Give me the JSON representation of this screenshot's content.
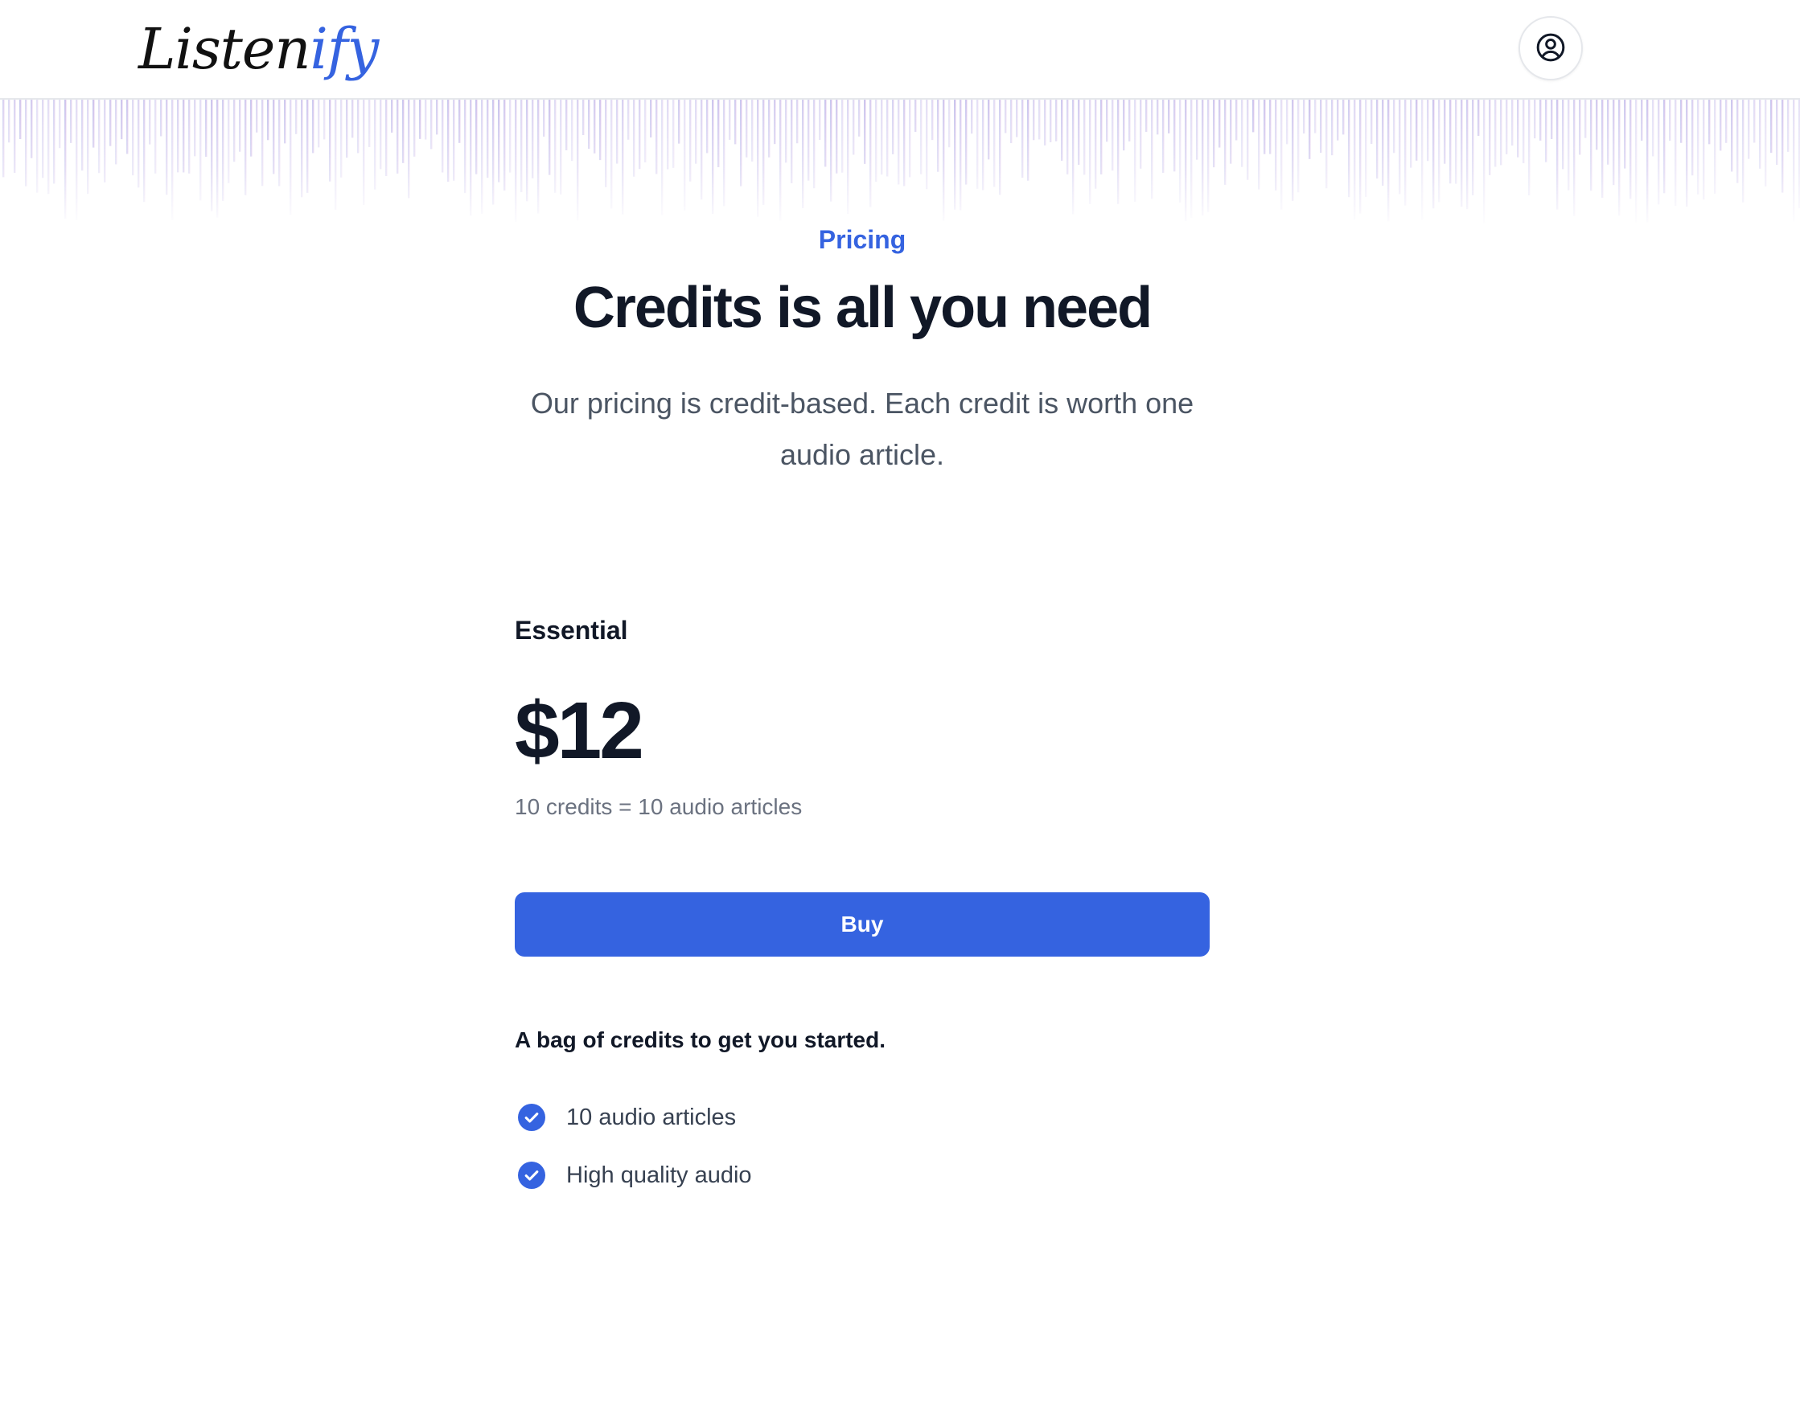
{
  "header": {
    "logo_part_a": "Listen",
    "logo_part_b": "ify",
    "account_icon": "user-circle-icon"
  },
  "hero": {
    "eyebrow": "Pricing",
    "title": "Credits is all you need",
    "subtitle": "Our pricing is credit-based. Each credit is worth one audio article."
  },
  "plan": {
    "name": "Essential",
    "price": "$12",
    "credits_note": "10 credits = 10 audio articles",
    "buy_label": "Buy",
    "tagline": "A bag of credits to get you started.",
    "features": [
      {
        "label": "10 audio articles",
        "icon": "check-circle-icon"
      },
      {
        "label": "High quality audio",
        "icon": "check-circle-icon"
      }
    ]
  },
  "colors": {
    "accent": "#3563e0",
    "text_primary": "#111827",
    "text_secondary": "#4b5563",
    "wave_start": "#b9c2ee",
    "wave_end": "#d9b8e6"
  }
}
